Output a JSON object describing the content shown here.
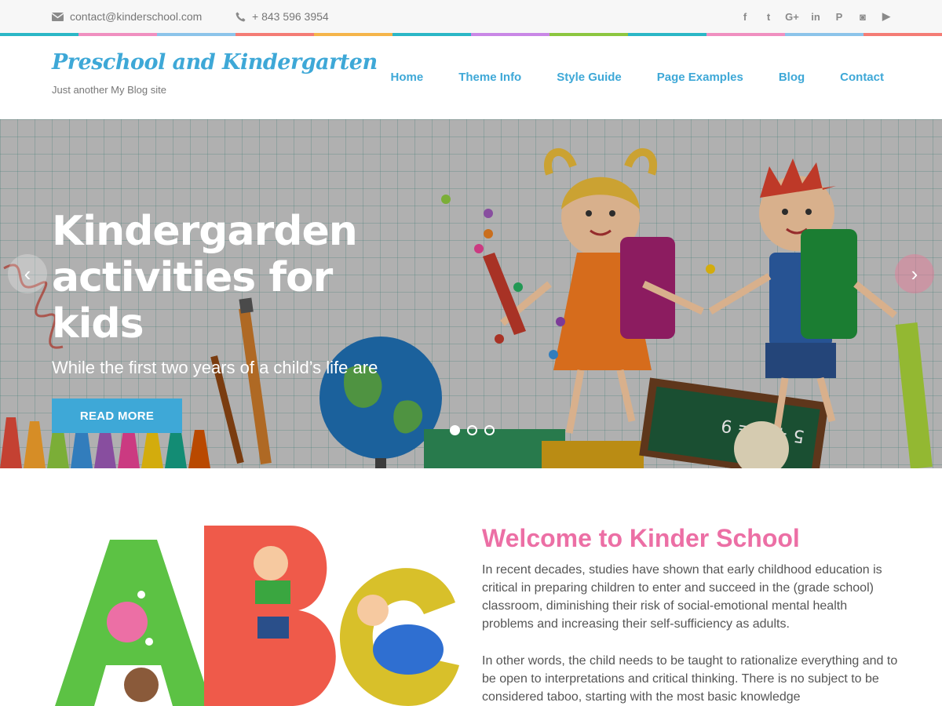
{
  "topbar": {
    "email": "contact@kinderschool.com",
    "phone": "+ 843 596 3954",
    "socials": [
      {
        "icon": "facebook-icon",
        "glyph": "f"
      },
      {
        "icon": "twitter-icon",
        "glyph": "t"
      },
      {
        "icon": "google-plus-icon",
        "glyph": "G+"
      },
      {
        "icon": "linkedin-icon",
        "glyph": "in"
      },
      {
        "icon": "pinterest-icon",
        "glyph": "P"
      },
      {
        "icon": "instagram-icon",
        "glyph": "◙"
      },
      {
        "icon": "youtube-icon",
        "glyph": "▶"
      }
    ],
    "band_colors": [
      "#2bb7c6",
      "#f08fc0",
      "#8cc4ea",
      "#f47c75",
      "#f5b54a",
      "#2bb7c6",
      "#c987e6",
      "#8cc63f",
      "#2bb7c6",
      "#f08fc0",
      "#8cc4ea",
      "#f47c75"
    ]
  },
  "header": {
    "site_title": "Preschool and Kindergarten",
    "tagline": "Just another My Blog site",
    "nav": [
      "Home",
      "Theme Info",
      "Style Guide",
      "Page Examples",
      "Blog",
      "Contact"
    ]
  },
  "hero": {
    "title": "Kindergarden activities for kids",
    "subtitle": "While the first two years of a child’s life are",
    "button": "READ MORE",
    "prev_arrow": "‹",
    "next_arrow": "›",
    "slides": 3,
    "active_slide": 1,
    "board_text": "5 + 4 = 9"
  },
  "welcome": {
    "title": "Welcome to Kinder School",
    "paragraph1": "In recent decades, studies have shown that early childhood education is critical in preparing children to enter and succeed in the (grade school) classroom, diminishing their risk of social-emotional mental health problems and increasing their self-sufficiency as adults.",
    "paragraph2": "In other words, the child needs to be taught to rationalize everything and to be open to interpretations and critical thinking. There is no subject to be considered taboo, starting with the most basic knowledge"
  },
  "colors": {
    "accent": "#3ea8d7",
    "pink": "#ec6fa5"
  }
}
